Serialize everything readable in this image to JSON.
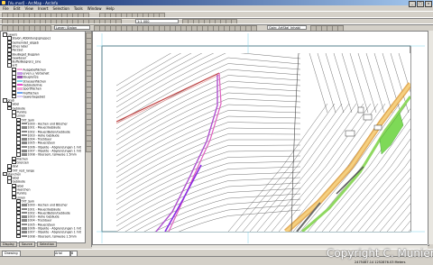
{
  "window": {
    "title": "[Vu.mxd] - ArcMap - ArcInfo",
    "buttons": [
      "_",
      "□",
      "×"
    ]
  },
  "menu": [
    "File",
    "Edit",
    "View",
    "Insert",
    "Selection",
    "Tools",
    "Window",
    "Help"
  ],
  "toolbar": {
    "layer_combo": "Layer: Stalon",
    "scale_combo": "1:1 000",
    "target_combo": "Gain: ArtStal_Inhabl"
  },
  "toc": {
    "tabs": [
      "Display",
      "Source",
      "Selection"
    ],
    "items": [
      {
        "text": "Layers",
        "level": 0
      },
      {
        "text": "Stalon_Abbildungsgruppe1",
        "level": 1
      },
      {
        "text": "Gemeindet_abgeb",
        "level": 1
      },
      {
        "text": "stnes label",
        "level": 1
      },
      {
        "text": "ParzSut",
        "level": 1
      },
      {
        "text": "BauBeget_Bugplan",
        "level": 1
      },
      {
        "text": "Gewässer",
        "level": 1
      },
      {
        "text": "BufferBeigrenz_Line",
        "level": 1
      },
      {
        "text": "arit",
        "level": 1
      },
      {
        "text": "Ausgabeflächen",
        "level": 2,
        "swatch": "pink"
      },
      {
        "text": "erven.u_Vorbehalt",
        "level": 2,
        "swatch": "violet"
      },
      {
        "text": "Baugrenze",
        "level": 2,
        "swatch": "purple"
      },
      {
        "text": "Strassenflächen",
        "level": 2,
        "swatch": "cyan"
      },
      {
        "text": "Gebäudelinie",
        "level": 2,
        "swatch": "magenta"
      },
      {
        "text": "Sportflächen",
        "level": 2,
        "swatch": "pink"
      },
      {
        "text": "Freiflächen",
        "level": 2,
        "swatch": "blue"
      },
      {
        "text": "Gewerbegebiet",
        "level": 2,
        "swatch": "lavender"
      },
      {
        "text": "grab",
        "level": 0
      },
      {
        "text": "label",
        "level": 1
      },
      {
        "text": "Gebäude",
        "level": 1
      },
      {
        "text": "Punkte",
        "level": 2
      },
      {
        "text": "Linien",
        "level": 2
      },
      {
        "text": "TXT_Sym",
        "level": 3
      },
      {
        "text": "1000 - Hochen und Böscher",
        "level": 3,
        "swatch": "gray"
      },
      {
        "text": "1001 - Mauer/Gebäude",
        "level": 3,
        "swatch": "gray"
      },
      {
        "text": "1002 - Mauer/Beton/Gebäude",
        "level": 3,
        "swatch": "gray"
      },
      {
        "text": "1003 - Hohe Gebäude",
        "level": 3,
        "swatch": "gray"
      },
      {
        "text": "1004 - Trockbaur",
        "level": 3,
        "swatch": "gray"
      },
      {
        "text": "1005 - Mauer/Zaun",
        "level": 3,
        "swatch": "gray"
      },
      {
        "text": "1006 - Objekte - Abgrenzungen 1 mit",
        "level": 3,
        "swatch": "gray"
      },
      {
        "text": "1007 - Objekte - Abgrenzungen 1 mit",
        "level": 3,
        "swatch": "gray"
      },
      {
        "text": "1008 - Obersem, teilweise 1.5mm",
        "level": 3,
        "swatch": "gray"
      },
      {
        "text": "Flächen",
        "level": 2
      },
      {
        "text": "Grenzen",
        "level": 2
      },
      {
        "text": "devi",
        "level": 1
      },
      {
        "text": "TXT_rest_range",
        "level": 1
      },
      {
        "text": "stanchen",
        "level": 0
      },
      {
        "text": "label",
        "level": 1
      },
      {
        "text": "Gebäude",
        "level": 1
      },
      {
        "text": "label",
        "level": 2
      },
      {
        "text": "Hasrchen",
        "level": 2
      },
      {
        "text": "Punkte",
        "level": 2
      },
      {
        "text": "Linien",
        "level": 2
      },
      {
        "text": "TXT_Sym",
        "level": 3
      },
      {
        "text": "1000 - Hochen und Böscher",
        "level": 3,
        "swatch": "gray"
      },
      {
        "text": "1001 - Mauer/Gebäude",
        "level": 3,
        "swatch": "gray"
      },
      {
        "text": "1002 - Mauer/Beton/Gebäude",
        "level": 3,
        "swatch": "gray"
      },
      {
        "text": "1003 - Hohe Gebäude",
        "level": 3,
        "swatch": "gray"
      },
      {
        "text": "1004 - Trockbaur",
        "level": 3,
        "swatch": "gray"
      },
      {
        "text": "1005 - Mauer/Zaun",
        "level": 3,
        "swatch": "gray"
      },
      {
        "text": "1006 - Objekte - Abgrenzungen 1 mit",
        "level": 3,
        "swatch": "gray"
      },
      {
        "text": "1007 - Objekte - Abgrenzungen 1 mit",
        "level": 3,
        "swatch": "gray"
      },
      {
        "text": "1008 - Obersem, teilweise 1.5mm",
        "level": 3,
        "swatch": "gray"
      }
    ]
  },
  "drawing": {
    "label": "Drawing",
    "font": "Arial",
    "size": "8"
  },
  "status": {
    "coordinates": "2475467.14  1252876.03 Meters"
  },
  "watermark": "Copyright C. Munier",
  "colors": {
    "swatches": {
      "pink": "#f6a6d8",
      "violet": "#c79be8",
      "purple": "#9b59b6",
      "cyan": "#7fd8e8",
      "magenta": "#e84fcf",
      "blue": "#6fa8f0",
      "lavender": "#d8c8f8",
      "gray": "#888888"
    }
  }
}
